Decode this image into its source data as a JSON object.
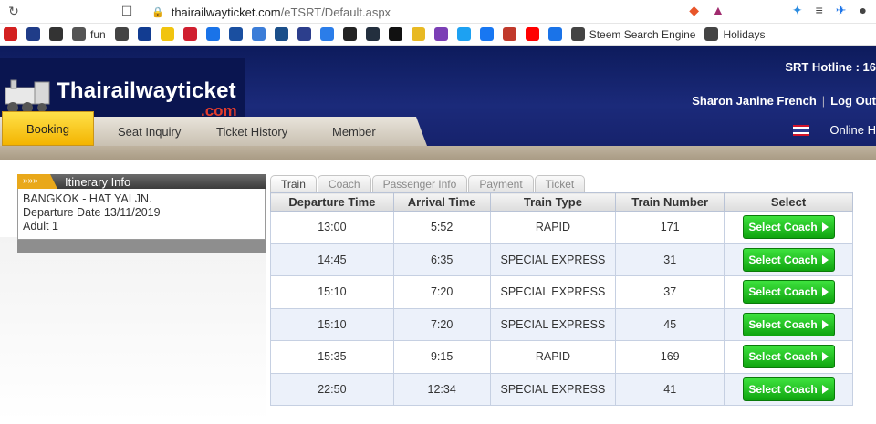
{
  "browser": {
    "url_host": "thairailwayticket.com",
    "url_path": "/eTSRT/Default.aspx",
    "bookmarks": [
      {
        "icon": "red-circle-icon",
        "color": "#d32020",
        "label": ""
      },
      {
        "icon": "b-icon",
        "color": "#1f3c88",
        "label": ""
      },
      {
        "icon": "shield-icon",
        "color": "#333333",
        "label": ""
      },
      {
        "icon": "car-icon",
        "color": "#555555",
        "label": "fun"
      },
      {
        "icon": "globe-icon",
        "color": "#444444",
        "label": ""
      },
      {
        "icon": "paypal-icon",
        "color": "#123c91",
        "label": ""
      },
      {
        "icon": "stripes-icon",
        "color": "#f1c40f",
        "label": ""
      },
      {
        "icon": "wing-icon",
        "color": "#d01f2f",
        "label": ""
      },
      {
        "icon": "copy-icon",
        "color": "#1a73e8",
        "label": ""
      },
      {
        "icon": "bx-icon",
        "color": "#1a4fa0",
        "label": ""
      },
      {
        "icon": "robot-icon",
        "color": "#3b7dd8",
        "label": ""
      },
      {
        "icon": "s-icon",
        "color": "#1b4f8a",
        "label": ""
      },
      {
        "icon": "list-icon",
        "color": "#2c3e8c",
        "label": ""
      },
      {
        "icon": "c-icon",
        "color": "#2b7de9",
        "label": ""
      },
      {
        "icon": "amazon-icon",
        "color": "#222222",
        "label": ""
      },
      {
        "icon": "amazon-box-icon",
        "color": "#232f3e",
        "label": ""
      },
      {
        "icon": "d-icon",
        "color": "#111111",
        "label": ""
      },
      {
        "icon": "pencil-icon",
        "color": "#e8b923",
        "label": ""
      },
      {
        "icon": "mail-icon",
        "color": "#7b3fb5",
        "label": ""
      },
      {
        "icon": "twitter-icon",
        "color": "#1da1f2",
        "label": ""
      },
      {
        "icon": "facebook-icon",
        "color": "#1877f2",
        "label": ""
      },
      {
        "icon": "k-icon",
        "color": "#c0392b",
        "label": ""
      },
      {
        "icon": "youtube-icon",
        "color": "#ff0000",
        "label": ""
      },
      {
        "icon": "runner-icon",
        "color": "#1a73e8",
        "label": ""
      },
      {
        "icon": "search-icon",
        "color": "#444444",
        "label": "Steem Search Engine"
      },
      {
        "icon": "globe-icon",
        "color": "#444444",
        "label": "Holidays"
      }
    ]
  },
  "header": {
    "logo_title": "Thairailwayticket",
    "logo_sub": ".com",
    "hotline": "SRT Hotline : 16",
    "user_name": "Sharon Janine French",
    "logout": "Log Out",
    "online_help": "Online H"
  },
  "nav": {
    "tabs": [
      "Booking",
      "Seat Inquiry",
      "Ticket History",
      "Member"
    ],
    "active": "Booking"
  },
  "itinerary": {
    "title": "Itinerary Info",
    "route": "BANGKOK - HAT YAI JN.",
    "departure": "Departure Date 13/11/2019",
    "passengers": "Adult 1"
  },
  "steps": [
    "Train",
    "Coach",
    "Passenger Info",
    "Payment",
    "Ticket"
  ],
  "table": {
    "headers": [
      "Departure Time",
      "Arrival Time",
      "Train Type",
      "Train Number",
      "Select"
    ],
    "button_label": "Select Coach",
    "rows": [
      {
        "dep": "13:00",
        "arr": "5:52",
        "type": "RAPID",
        "num": "171"
      },
      {
        "dep": "14:45",
        "arr": "6:35",
        "type": "SPECIAL EXPRESS",
        "num": "31"
      },
      {
        "dep": "15:10",
        "arr": "7:20",
        "type": "SPECIAL EXPRESS",
        "num": "37"
      },
      {
        "dep": "15:10",
        "arr": "7:20",
        "type": "SPECIAL EXPRESS",
        "num": "45"
      },
      {
        "dep": "15:35",
        "arr": "9:15",
        "type": "RAPID",
        "num": "169"
      },
      {
        "dep": "22:50",
        "arr": "12:34",
        "type": "SPECIAL EXPRESS",
        "num": "41"
      }
    ]
  },
  "colors": {
    "header_bg": "#16226c",
    "booking_tab": "#f3b400",
    "button_green": "#1cc01c",
    "logo_red": "#e23c2c"
  }
}
